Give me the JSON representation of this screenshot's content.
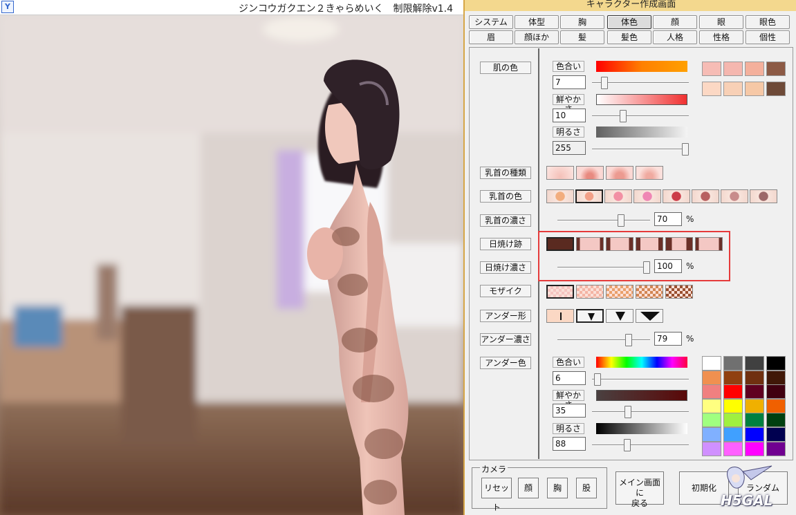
{
  "window": {
    "title": "ジンコウガクエン２きゃらめいく　制限解除v1.4",
    "app_icon": "Y",
    "panel_title": "キャラクター作成画面"
  },
  "tabs": [
    {
      "label": "システム",
      "active": false
    },
    {
      "label": "体型",
      "active": false
    },
    {
      "label": "胸",
      "active": false
    },
    {
      "label": "体色",
      "active": true
    },
    {
      "label": "顔",
      "active": false
    },
    {
      "label": "眼",
      "active": false
    },
    {
      "label": "眼色",
      "active": false
    },
    {
      "label": "眉",
      "active": false
    },
    {
      "label": "顔ほか",
      "active": false
    },
    {
      "label": "髪",
      "active": false
    },
    {
      "label": "髪色",
      "active": false
    },
    {
      "label": "人格",
      "active": false
    },
    {
      "label": "性格",
      "active": false
    },
    {
      "label": "個性",
      "active": false
    }
  ],
  "skin": {
    "label": "肌の色",
    "hue": {
      "label": "色合い",
      "value": "7",
      "level": 0.1
    },
    "saturation": {
      "label": "鮮やかさ",
      "value": "10",
      "level": 0.31
    },
    "brightness": {
      "label": "明るさ",
      "value": "255",
      "level": 1.0
    },
    "swatches": [
      "#f6bcb5",
      "#f5b7af",
      "#f4b09c",
      "#8c5a45",
      "#fcd8c4",
      "#f8d0b6",
      "#f6c8a6",
      "#6e4a38"
    ]
  },
  "nipple_type": {
    "label": "乳首の種類"
  },
  "nipple_color": {
    "label": "乳首の色",
    "colors": [
      "#f2ad7e",
      "#f2a088",
      "#f290a4",
      "#ef86b4",
      "#cc3c48",
      "#b86060",
      "#c88c8c",
      "#9c6868"
    ]
  },
  "nipple_depth": {
    "label": "乳首の濃さ",
    "value": "70",
    "unit": "%",
    "level": 0.7
  },
  "tan_lines": {
    "label": "日焼け跡"
  },
  "tan_depth": {
    "label": "日焼け濃さ",
    "value": "100",
    "unit": "%",
    "level": 1.0
  },
  "mosaic": {
    "label": "モザイク",
    "colors": [
      "#f6c4c0",
      "#f4b4a4",
      "#eaa06c",
      "#d28654",
      "#9a5030"
    ]
  },
  "under_shape": {
    "label": "アンダー形"
  },
  "under_depth": {
    "label": "アンダー濃さ",
    "value": "79",
    "unit": "%",
    "level": 0.79
  },
  "under_color": {
    "label": "アンダー色",
    "hue": {
      "label": "色合い",
      "value": "6",
      "level": 0.02
    },
    "saturation": {
      "label": "鮮やかさ",
      "value": "35",
      "level": 0.36
    },
    "brightness": {
      "label": "明るさ",
      "value": "88",
      "level": 0.35
    },
    "palette": [
      "#ffffff",
      "#707070",
      "#404040",
      "#000000",
      "#f09050",
      "#904010",
      "#703010",
      "#401808",
      "#f08080",
      "#ff0000",
      "#600020",
      "#400010",
      "#ffff80",
      "#ffff00",
      "#f0b000",
      "#f06000",
      "#a0ff80",
      "#a0f040",
      "#008040",
      "#004010",
      "#80b0ff",
      "#40a0ff",
      "#0000ff",
      "#000050",
      "#d090ff",
      "#ff60ff",
      "#ff00ff",
      "#700090"
    ]
  },
  "camera": {
    "group_label": "カメラ",
    "reset": "リセット",
    "face": "顔",
    "chest": "胸",
    "crotch": "股"
  },
  "bottom": {
    "main_screen_line1": "メイン画面に",
    "main_screen_line2": "戻る",
    "initialize": "初期化",
    "random": "ランダム"
  },
  "watermark": "H5GAL"
}
